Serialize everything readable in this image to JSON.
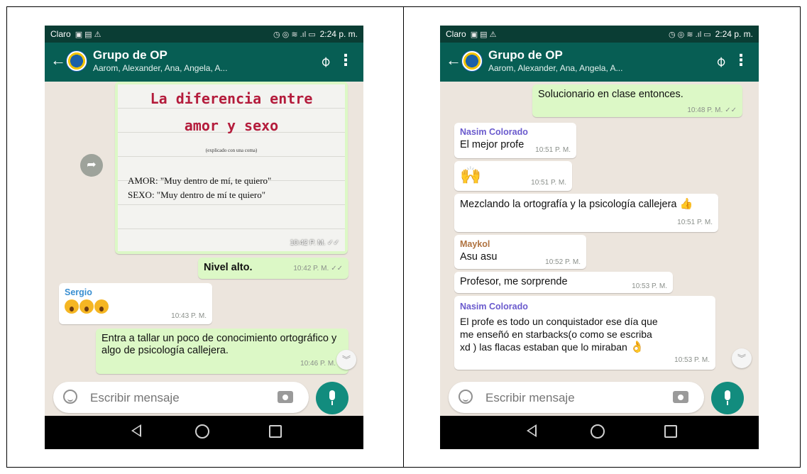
{
  "status_bar": {
    "carrier": "Claro",
    "time": "2:24 p. m."
  },
  "chat_header": {
    "title": "Grupo de OP",
    "members": "Aarom, Alexander, Ana, Angela, A..."
  },
  "input": {
    "placeholder": "Escribir mensaje"
  },
  "colors": {
    "header": "#075e54",
    "status_bar": "#0a3d34",
    "outgoing": "#dcf8c6",
    "incoming": "#ffffff",
    "chat_bg": "#ece5dd",
    "mic": "#128c7e"
  },
  "left": {
    "image": {
      "title_line1": "La diferencia entre",
      "title_line2": "amor y sexo",
      "subtitle": "(explicado con una coma)",
      "line1": "AMOR: \"Muy dentro de mí, te quiero\"",
      "line2": "SEXO: \"Muy dentro de mí te quiero\"",
      "time": "10:42 P. M."
    },
    "messages": [
      {
        "text": "Nivel alto.",
        "time": "10:42 P. M."
      },
      {
        "sender": "Sergio",
        "time": "10:43 P. M."
      },
      {
        "text": "Entra a tallar un poco de conocimiento ortográfico y algo de psicología callejera.",
        "time": "10:46 P. M."
      }
    ]
  },
  "right": {
    "messages": [
      {
        "text": "Solucionario en clase entonces.",
        "time": "10:48 P. M."
      },
      {
        "sender": "Nasim Colorado",
        "text": "El mejor profe",
        "time": "10:51 P. M."
      },
      {
        "time": "10:51 P. M."
      },
      {
        "text": "Mezclando la ortografía y la psicología callejera",
        "time": "10:51 P. M."
      },
      {
        "sender": "Maykol",
        "text": "Asu asu",
        "time": "10:52 P. M."
      },
      {
        "text": "Profesor, me sorprende",
        "time": "10:53 P. M."
      },
      {
        "sender": "Nasim Colorado",
        "text": "El profe es todo un conquistador ese día que me enseñó en starbacks(o como se escriba xd ) las flacas estaban que lo miraban",
        "time": "10:53 P. M."
      }
    ]
  }
}
